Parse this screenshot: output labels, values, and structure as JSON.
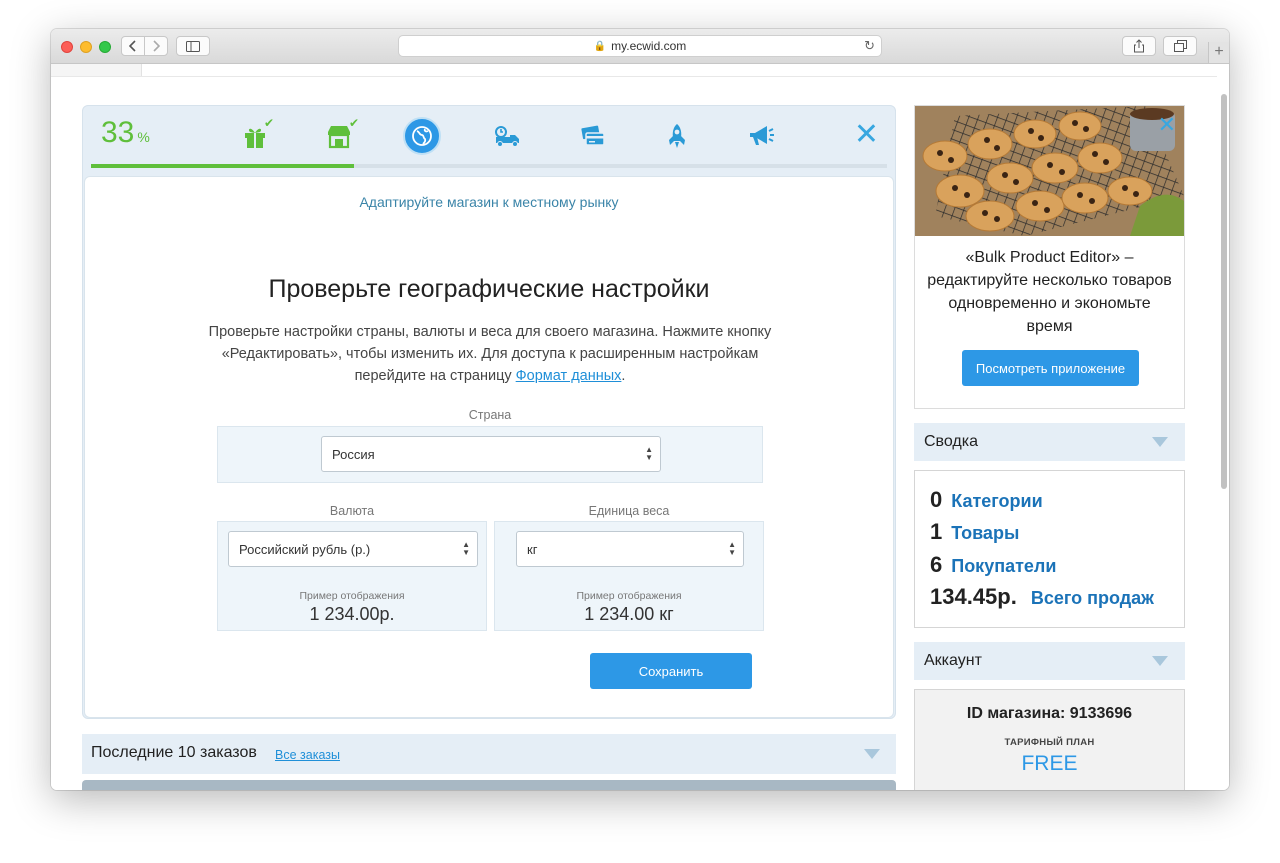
{
  "browser": {
    "url": "my.ecwid.com"
  },
  "onboarding": {
    "progress_value": "33",
    "progress_unit": "%",
    "progress_fraction": 0.33,
    "steps": [
      {
        "icon": "gift-icon",
        "done": true
      },
      {
        "icon": "storefront-icon",
        "done": true
      },
      {
        "icon": "globe-icon",
        "active": true
      },
      {
        "icon": "delivery-truck-icon"
      },
      {
        "icon": "credit-card-icon"
      },
      {
        "icon": "rocket-icon"
      },
      {
        "icon": "megaphone-icon"
      }
    ],
    "check_mark": "✔",
    "close_glyph": "✕",
    "subtitle": "Адаптируйте магазин к местному рынку",
    "heading": "Проверьте географические настройки",
    "description_pre": "Проверьте настройки страны, валюты и веса для своего магазина. Нажмите кнопку «Редактировать», чтобы изменить их. Для доступа к расширенным настройкам перейдите на страницу ",
    "description_link": "Формат данных",
    "description_post": ".",
    "country": {
      "label": "Страна",
      "value": "Россия"
    },
    "currency": {
      "label": "Валюта",
      "value": "Российский рубль (р.)",
      "example_label": "Пример отображения",
      "example_value": "1 234.00р."
    },
    "weight": {
      "label": "Единица веса",
      "value": "кг",
      "example_label": "Пример отображения",
      "example_value": "1 234.00 кг"
    },
    "save_label": "Сохранить"
  },
  "orders": {
    "title": "Последние 10 заказов",
    "all_link": "Все заказы"
  },
  "promo": {
    "text": "«Bulk Product Editor» – редактируйте несколько товаров одновременно и экономьте время",
    "button": "Посмотреть приложение",
    "close_glyph": "✕"
  },
  "summary": {
    "title": "Сводка",
    "rows": [
      {
        "num": "0",
        "label": "Категории"
      },
      {
        "num": "1",
        "label": "Товары"
      },
      {
        "num": "6",
        "label": "Покупатели"
      },
      {
        "num": "134.45р.",
        "label": "Всего продаж"
      }
    ]
  },
  "account": {
    "title": "Аккаунт",
    "store_id": "ID магазина: 9133696",
    "plan_label": "ТАРИФНЫЙ ПЛАН",
    "plan": "FREE"
  },
  "colors": {
    "accent_green": "#5fbf3b",
    "accent_blue": "#2d98e6",
    "link_blue": "#1b73b8",
    "icon_teal": "#2a9ad6"
  }
}
